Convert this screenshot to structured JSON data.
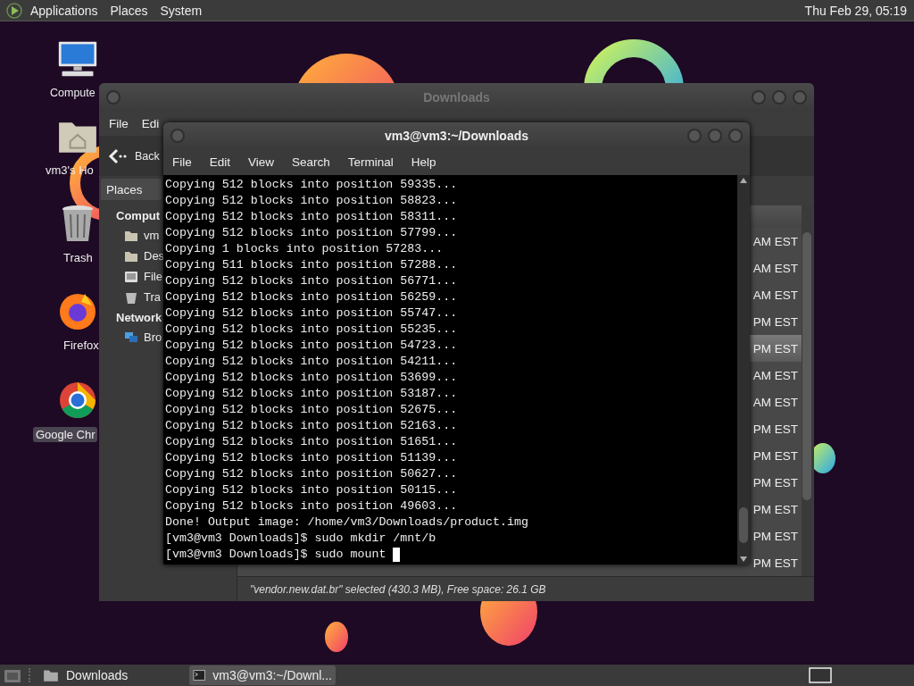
{
  "top_panel": {
    "menus": [
      "Applications",
      "Places",
      "System"
    ],
    "clock": "Thu Feb 29, 05:19"
  },
  "desktop_icons": [
    {
      "label": "Compute",
      "kind": "computer",
      "selected": false
    },
    {
      "label": "vm3's Ho",
      "kind": "home",
      "selected": false
    },
    {
      "label": "Trash",
      "kind": "trash",
      "selected": false
    },
    {
      "label": "Firefox",
      "kind": "fox",
      "selected": false
    },
    {
      "label": "Google Chr",
      "kind": "ring",
      "selected": true
    }
  ],
  "file_manager": {
    "title": "Downloads",
    "menus": [
      "File",
      "Edi"
    ],
    "back_button": "Back",
    "places_button": "Places",
    "sidebar": [
      {
        "heading": "Comput",
        "items": [
          {
            "label": "vm",
            "kind": "home"
          },
          {
            "label": "Des",
            "kind": "desktop"
          },
          {
            "label": "File",
            "kind": "disk"
          },
          {
            "label": "Tra",
            "kind": "trash"
          }
        ]
      },
      {
        "heading": "Network",
        "items": [
          {
            "label": "Bro",
            "kind": "network"
          }
        ]
      }
    ],
    "rows": [
      {
        "modified": "AM EST",
        "selected": false
      },
      {
        "modified": "AM EST",
        "selected": false
      },
      {
        "modified": "AM EST",
        "selected": false
      },
      {
        "modified": "PM EST",
        "selected": false
      },
      {
        "modified": "PM EST",
        "selected": true
      },
      {
        "modified": "AM EST",
        "selected": false
      },
      {
        "modified": "AM EST",
        "selected": false
      },
      {
        "modified": "PM EST",
        "selected": false
      },
      {
        "modified": "PM EST",
        "selected": false
      },
      {
        "modified": "PM EST",
        "selected": false
      },
      {
        "modified": "PM EST",
        "selected": false
      },
      {
        "modified": "PM EST",
        "selected": false
      },
      {
        "modified": "PM EST",
        "selected": false
      }
    ],
    "status": "\"vendor.new.dat.br\" selected (430.3 MB), Free space: 26.1 GB"
  },
  "terminal": {
    "title": "vm3@vm3:~/Downloads",
    "menus": [
      "File",
      "Edit",
      "View",
      "Search",
      "Terminal",
      "Help"
    ],
    "lines": [
      "Copying 512 blocks into position 59335...",
      "Copying 512 blocks into position 58823...",
      "Copying 512 blocks into position 58311...",
      "Copying 512 blocks into position 57799...",
      "Copying 1 blocks into position 57283...",
      "Copying 511 blocks into position 57288...",
      "Copying 512 blocks into position 56771...",
      "Copying 512 blocks into position 56259...",
      "Copying 512 blocks into position 55747...",
      "Copying 512 blocks into position 55235...",
      "Copying 512 blocks into position 54723...",
      "Copying 512 blocks into position 54211...",
      "Copying 512 blocks into position 53699...",
      "Copying 512 blocks into position 53187...",
      "Copying 512 blocks into position 52675...",
      "Copying 512 blocks into position 52163...",
      "Copying 512 blocks into position 51651...",
      "Copying 512 blocks into position 51139...",
      "Copying 512 blocks into position 50627...",
      "Copying 512 blocks into position 50115...",
      "Copying 512 blocks into position 49603...",
      "Done! Output image: /home/vm3/Downloads/product.img",
      "[vm3@vm3 Downloads]$ sudo mkdir /mnt/b",
      "[vm3@vm3 Downloads]$ sudo mount"
    ],
    "cursor": true
  },
  "taskbar": {
    "tasks": [
      {
        "label": "Downloads",
        "kind": "folder",
        "selected": false
      },
      {
        "label": "vm3@vm3:~/Downl...",
        "kind": "terminal",
        "selected": true
      }
    ]
  }
}
